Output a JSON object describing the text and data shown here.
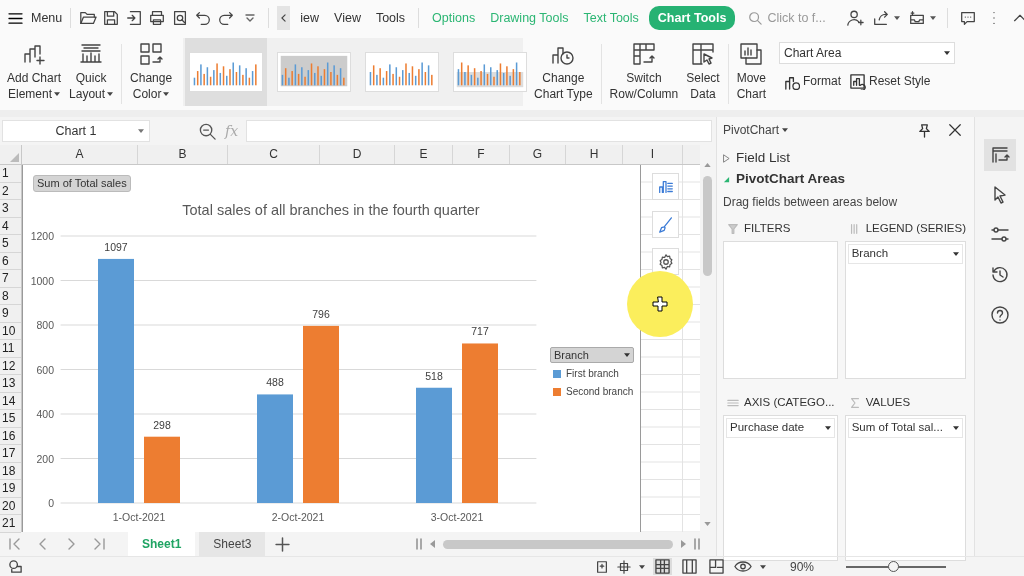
{
  "top_bar": {
    "menu": "Menu",
    "tabs": [
      {
        "label": "iew",
        "kind": "main",
        "selected": false
      },
      {
        "label": "View",
        "kind": "main",
        "selected": false
      },
      {
        "label": "Tools",
        "kind": "main",
        "selected": false
      },
      {
        "label": "Options",
        "kind": "context",
        "selected": false
      },
      {
        "label": "Drawing Tools",
        "kind": "context",
        "selected": false
      },
      {
        "label": "Text Tools",
        "kind": "context",
        "selected": false
      },
      {
        "label": "Chart Tools",
        "kind": "context",
        "selected": true
      }
    ],
    "search": {
      "placeholder": "Click to f..."
    }
  },
  "ribbon": {
    "buttons": [
      {
        "label": "Add Chart\nElement",
        "dropdown": true
      },
      {
        "label": "Quick\nLayout",
        "dropdown": true
      },
      {
        "label": "Change\nColor",
        "dropdown": true
      }
    ],
    "styles": [
      {
        "selected": true
      },
      {
        "selected": false
      },
      {
        "selected": false
      },
      {
        "selected": false
      }
    ],
    "buttons_2": [
      {
        "label": "Change\nChart Type",
        "dropdown": false
      },
      {
        "label": "Switch\nRow/Column",
        "dropdown": false
      },
      {
        "label": "Select\nData",
        "dropdown": false
      },
      {
        "label": "Move\nChart",
        "dropdown": false
      }
    ],
    "element_select": {
      "value": "Chart Area"
    },
    "actions": [
      {
        "label": "Format"
      },
      {
        "label": "Reset Style"
      }
    ]
  },
  "formula_bar": {
    "name_box": "Chart 1",
    "fx": "fx"
  },
  "sheet": {
    "columns": [
      "A",
      "B",
      "C",
      "D",
      "E",
      "F",
      "G",
      "H",
      "I"
    ],
    "rows": [
      "1",
      "2",
      "3",
      "4",
      "5",
      "6",
      "7",
      "8",
      "9",
      "10",
      "11",
      "12",
      "13",
      "14",
      "15",
      "16",
      "17",
      "18",
      "19",
      "20",
      "21"
    ],
    "chart": {
      "field_button": "Sum of Total sales",
      "legend_filter": "Branch",
      "chart_data": {
        "type": "bar",
        "title": "Total sales of all branches in the fourth quarter",
        "categories": [
          "1-Oct-2021",
          "2-Oct-2021",
          "3-Oct-2021"
        ],
        "series": [
          {
            "name": "First branch",
            "color": "#5b9bd5",
            "values": [
              1097,
              488,
              518
            ]
          },
          {
            "name": "Second branch",
            "color": "#ed7d31",
            "values": [
              298,
              796,
              717
            ]
          }
        ],
        "ylim": [
          0,
          1200
        ],
        "yticks": [
          0,
          200,
          400,
          600,
          800,
          1000,
          1200
        ],
        "data_labels": true,
        "grid": true,
        "legend": true
      }
    },
    "sheet_tabs": [
      {
        "label": "Sheet1",
        "selected": true
      },
      {
        "label": "Sheet3",
        "selected": false
      }
    ]
  },
  "pivot_pane": {
    "title": "PivotChart",
    "sections": [
      {
        "label": "Field List",
        "expanded": false
      },
      {
        "label": "PivotChart Areas",
        "expanded": true
      }
    ],
    "hint": "Drag fields between areas below",
    "areas": [
      {
        "kind": "filters",
        "label": "FILTERS"
      },
      {
        "kind": "legend",
        "label": "LEGEND (SERIES)",
        "fields": [
          "Branch"
        ]
      },
      {
        "kind": "axis",
        "label": "AXIS (CATEGO...",
        "fields": [
          "Purchase date"
        ]
      },
      {
        "kind": "values",
        "label": "VALUES",
        "fields": [
          "Sum of Total sal..."
        ]
      }
    ]
  },
  "side_tools": [
    {
      "selected": true
    },
    {
      "selected": false
    },
    {
      "selected": false
    },
    {
      "selected": false
    },
    {
      "selected": false
    }
  ],
  "status_bar": {
    "views": [
      {
        "selected": true
      },
      {
        "selected": false
      },
      {
        "selected": false
      }
    ],
    "zoom": "90%",
    "zoom_slider": {
      "level": 0.47
    }
  }
}
